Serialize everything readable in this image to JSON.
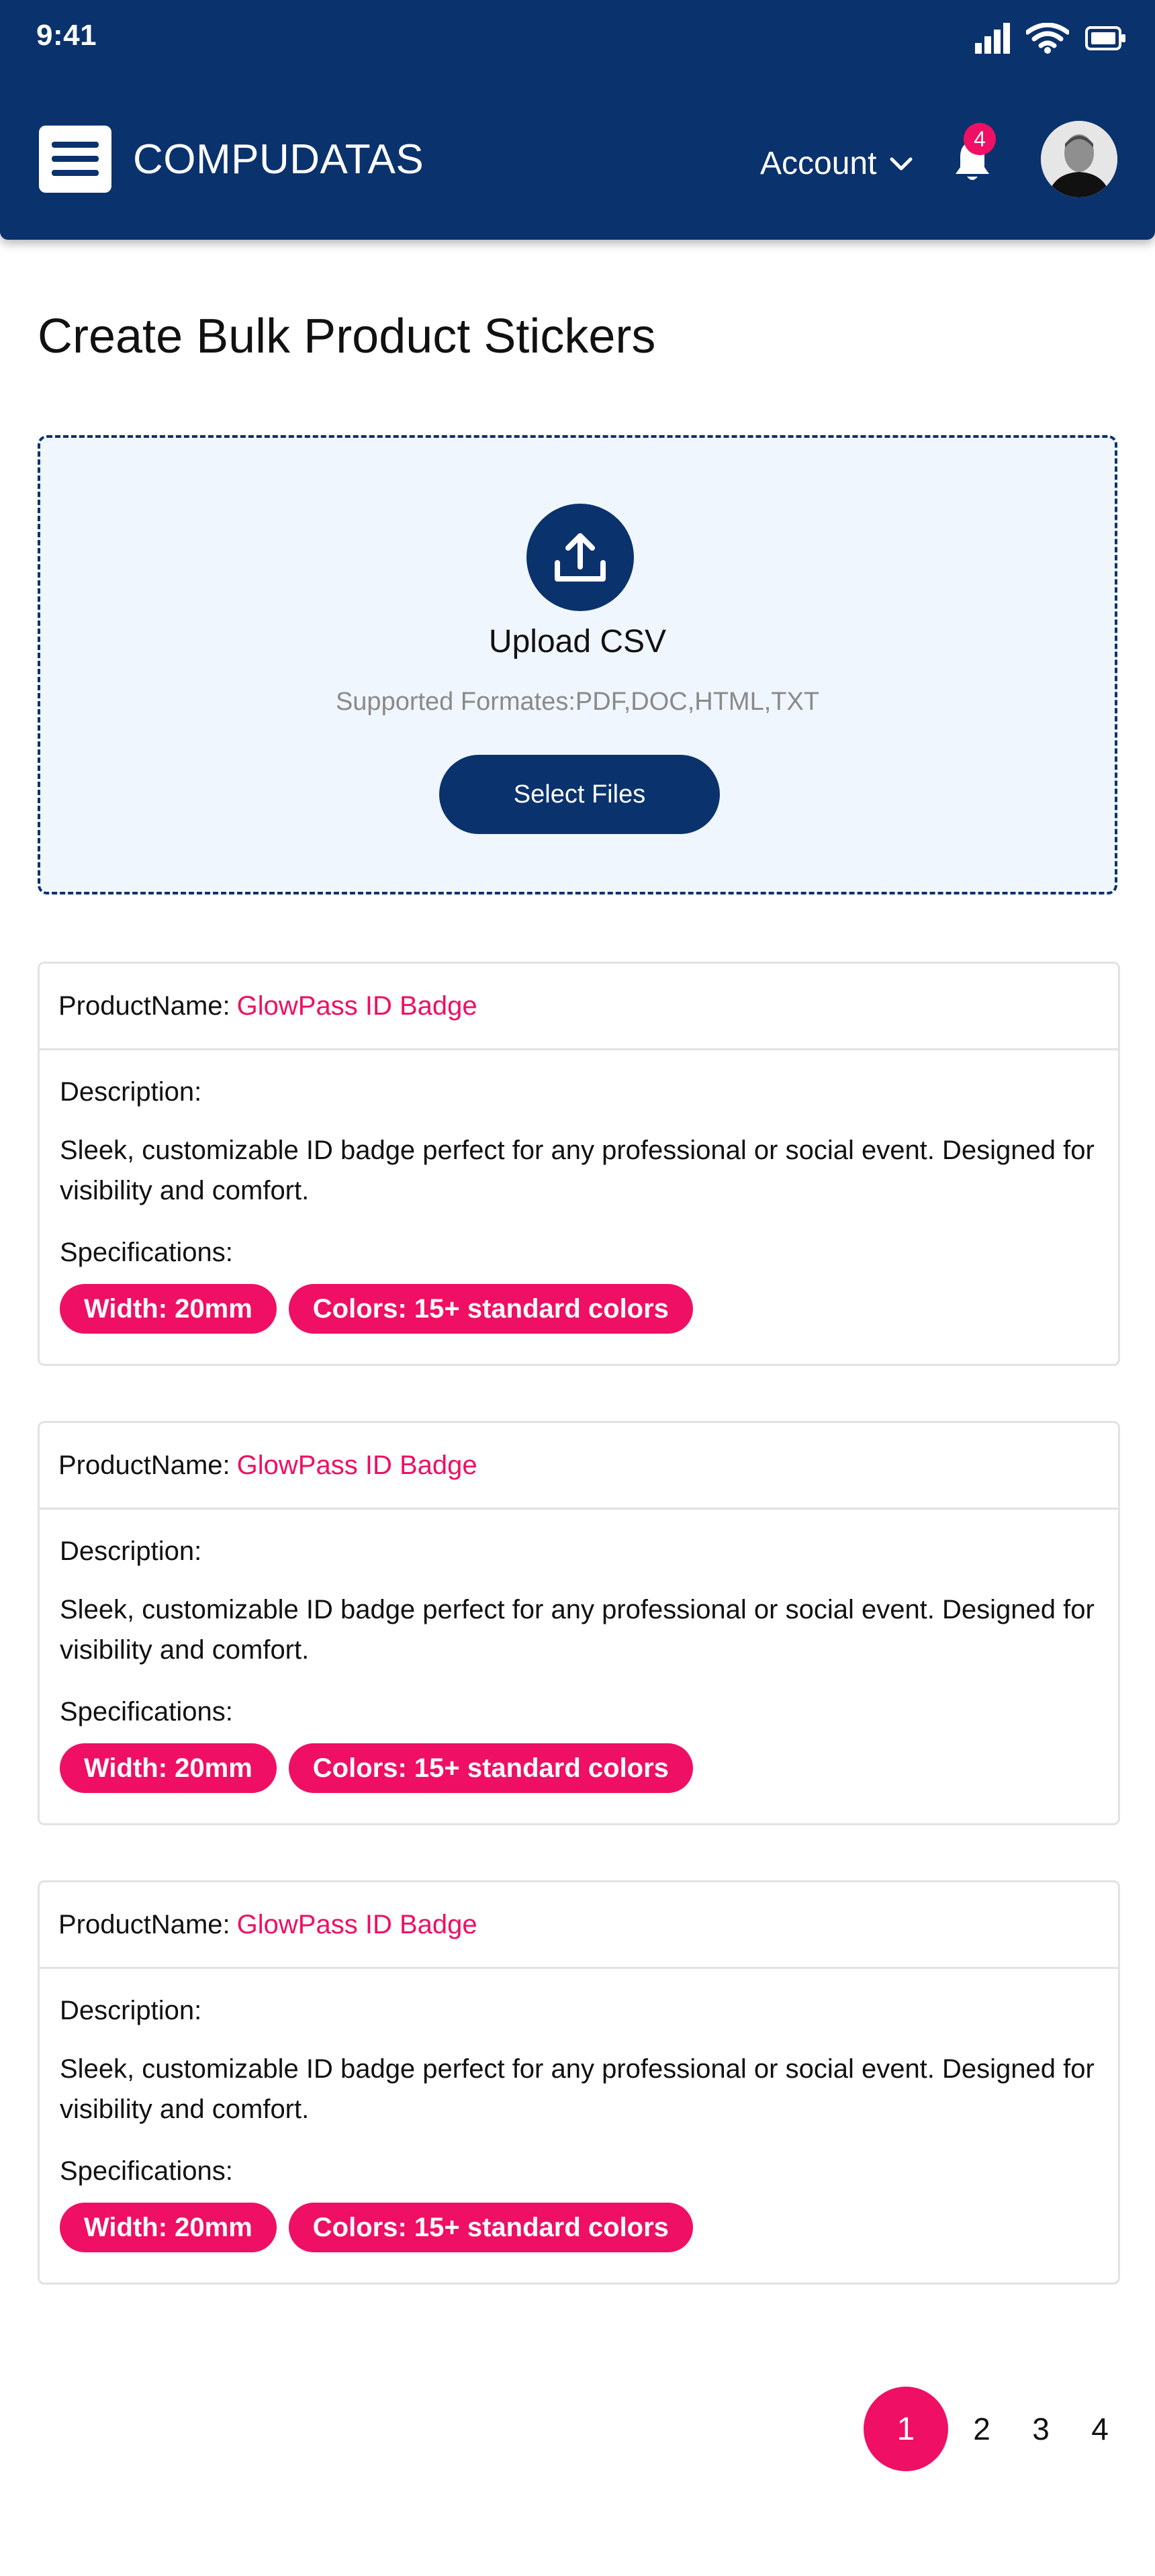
{
  "status_bar": {
    "time": "9:41",
    "icons": [
      "cellular-signal-icon",
      "wifi-icon",
      "battery-icon"
    ]
  },
  "header": {
    "brand": "COMPUDATAS",
    "account_label": "Account",
    "notification_count": "4",
    "colors": {
      "primary": "#0a326d",
      "accent": "#ef0f64"
    }
  },
  "page": {
    "title": "Create Bulk Product Stickers"
  },
  "upload": {
    "title": "Upload CSV",
    "subtitle": "Supported Formates:PDF,DOC,HTML,TXT",
    "button_label": "Select Files"
  },
  "products": [
    {
      "name_label": "ProductName:",
      "name": "GlowPass ID Badge",
      "description_label": "Description:",
      "description": "Sleek, customizable ID badge perfect for any professional or social event. Designed for visibility and comfort.",
      "specs_label": "Specifications:",
      "specs": [
        "Width: 20mm",
        "Colors: 15+ standard colors"
      ]
    },
    {
      "name_label": "ProductName:",
      "name": "GlowPass ID Badge",
      "description_label": "Description:",
      "description": "Sleek, customizable ID badge perfect for any professional or social event. Designed for visibility and comfort.",
      "specs_label": "Specifications:",
      "specs": [
        "Width: 20mm",
        "Colors: 15+ standard colors"
      ]
    },
    {
      "name_label": "ProductName:",
      "name": "GlowPass ID Badge",
      "description_label": "Description:",
      "description": "Sleek, customizable ID badge perfect for any professional or social event. Designed for visibility and comfort.",
      "specs_label": "Specifications:",
      "specs": [
        "Width: 20mm",
        "Colors: 15+ standard colors"
      ]
    }
  ],
  "pagination": {
    "pages": [
      "1",
      "2",
      "3",
      "4"
    ],
    "current": "1"
  }
}
